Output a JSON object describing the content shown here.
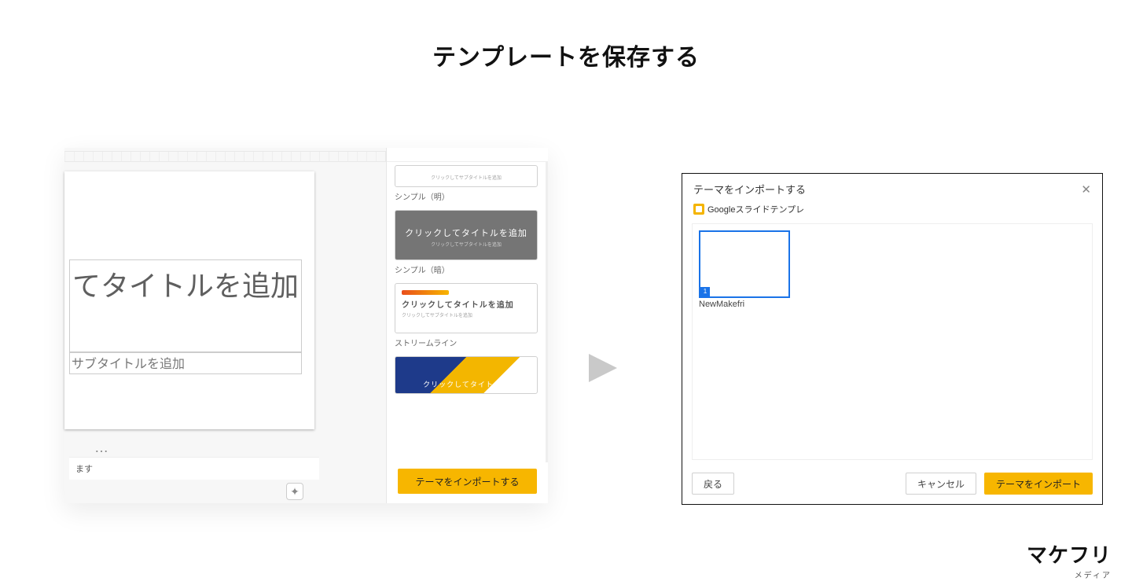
{
  "page": {
    "title": "テンプレートを保存する"
  },
  "left": {
    "slide": {
      "title_placeholder": "てタイトルを追加",
      "subtitle_placeholder": "サブタイトルを追加"
    },
    "footer_text": "ます",
    "theme_sidebar": {
      "cards": [
        {
          "sub": "クリックしてサブタイトルを追加"
        },
        {
          "caption": "シンプル（明）"
        },
        {
          "title": "クリックしてタイトルを追加",
          "sub": "クリックしてサブタイトルを追加"
        },
        {
          "caption": "シンプル（暗）"
        },
        {
          "title": "クリックしてタイトルを追加",
          "sub": "クリックしてサブタイトルを追加"
        },
        {
          "caption": "ストリームライン"
        },
        {
          "title": "クリックしてタイトルを"
        }
      ],
      "import_button": "テーマをインポートする"
    }
  },
  "right": {
    "title": "テーマをインポートする",
    "crumb": "Googleスライドテンプレ",
    "thumb_name": "NewMakefri",
    "back_button": "戻る",
    "cancel_button": "キャンセル",
    "import_button": "テーマをインポート"
  },
  "brand": {
    "main": "マケフリ",
    "sub": "メディア"
  }
}
